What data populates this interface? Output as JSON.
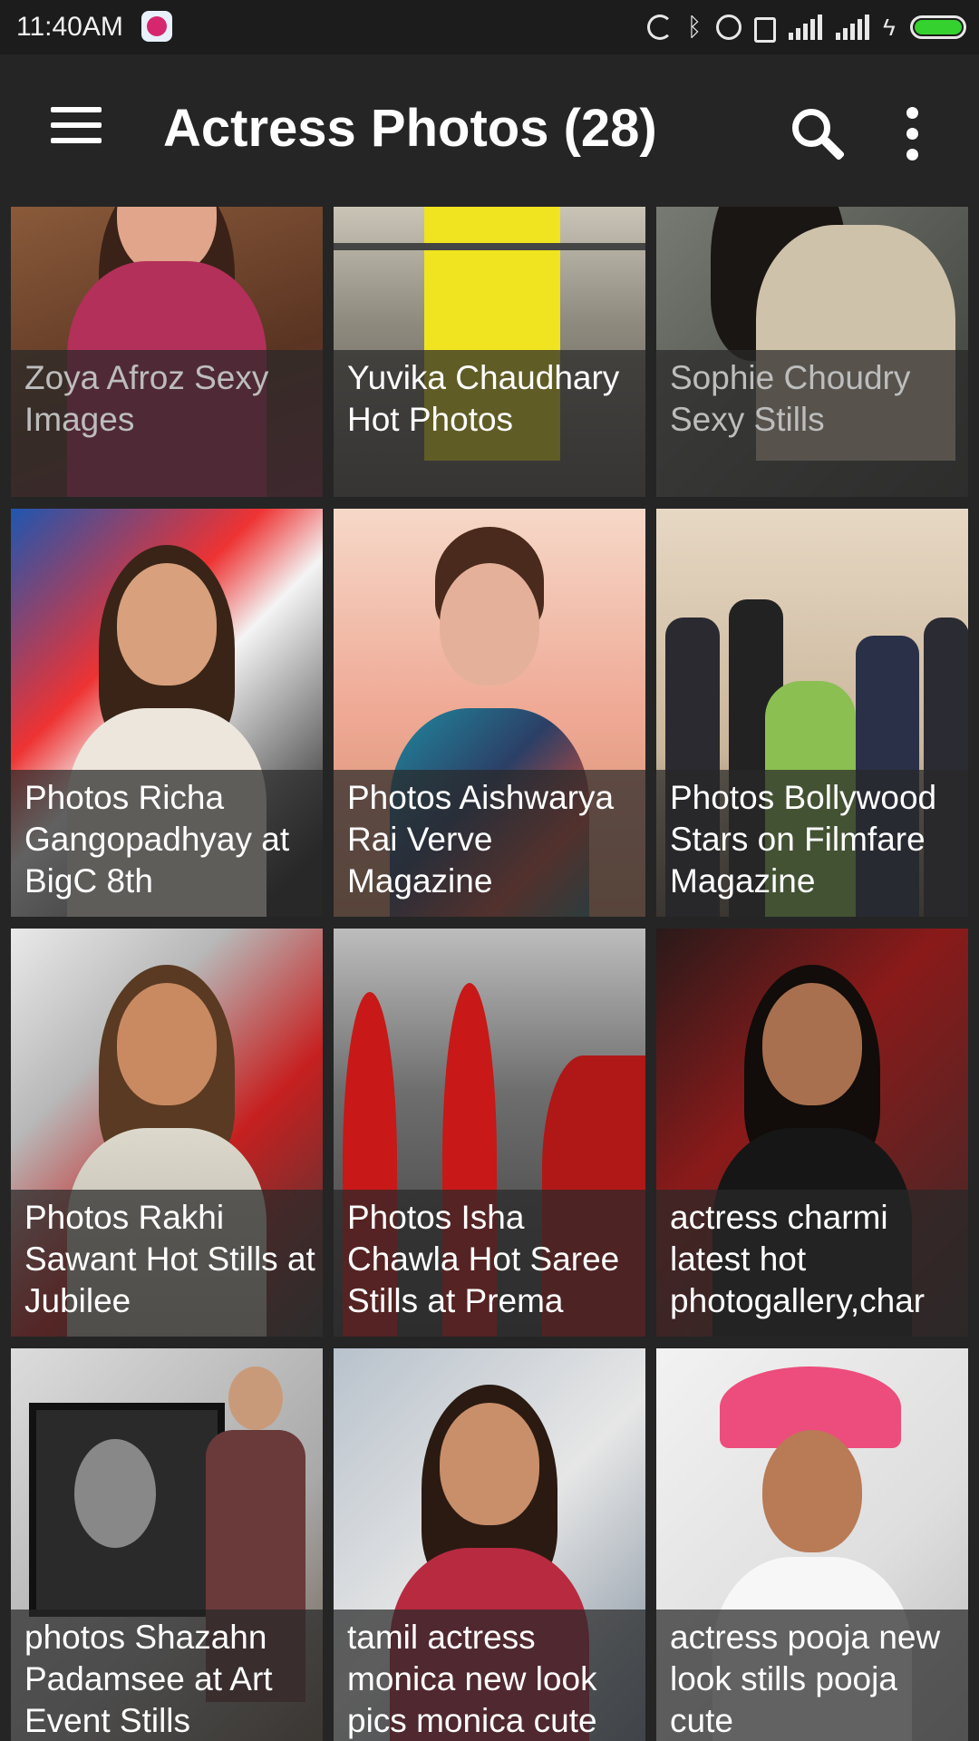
{
  "status_bar": {
    "time": "11:40AM",
    "icons": [
      "app-notification-icon",
      "sync-icon",
      "bluetooth-icon",
      "alarm-icon",
      "lock-icon",
      "signal-icon",
      "signal-icon",
      "charging-icon",
      "battery-icon"
    ]
  },
  "app_bar": {
    "title": "Actress Photos (28)",
    "menu_icon": "hamburger-menu-icon",
    "search_icon": "search-icon",
    "overflow_icon": "more-vert-icon"
  },
  "tiles": [
    {
      "caption": "Zoya Afroz Sexy Images",
      "dimmed": true
    },
    {
      "caption": "Yuvika Chaudhary Hot Photos",
      "dimmed": false
    },
    {
      "caption": "Sophie Choudry Sexy Stills",
      "dimmed": true
    },
    {
      "caption": "Photos Richa Gangopadhyay at BigC 8th",
      "dimmed": false
    },
    {
      "caption": "Photos Aishwarya Rai Verve Magazine",
      "dimmed": false
    },
    {
      "caption": "Photos Bollywood Stars on Filmfare Magazine",
      "dimmed": false
    },
    {
      "caption": "Photos Rakhi Sawant Hot Stills at Jubilee",
      "dimmed": false
    },
    {
      "caption": "Photos Isha Chawla Hot Saree Stills at Prema",
      "dimmed": false
    },
    {
      "caption": "actress charmi latest hot photogallery,char",
      "dimmed": false
    },
    {
      "caption": "photos Shazahn Padamsee at Art Event Stills",
      "dimmed": false
    },
    {
      "caption": "tamil actress monica new look pics monica cute",
      "dimmed": false
    },
    {
      "caption": "actress pooja new look stills pooja cute",
      "dimmed": false
    }
  ]
}
